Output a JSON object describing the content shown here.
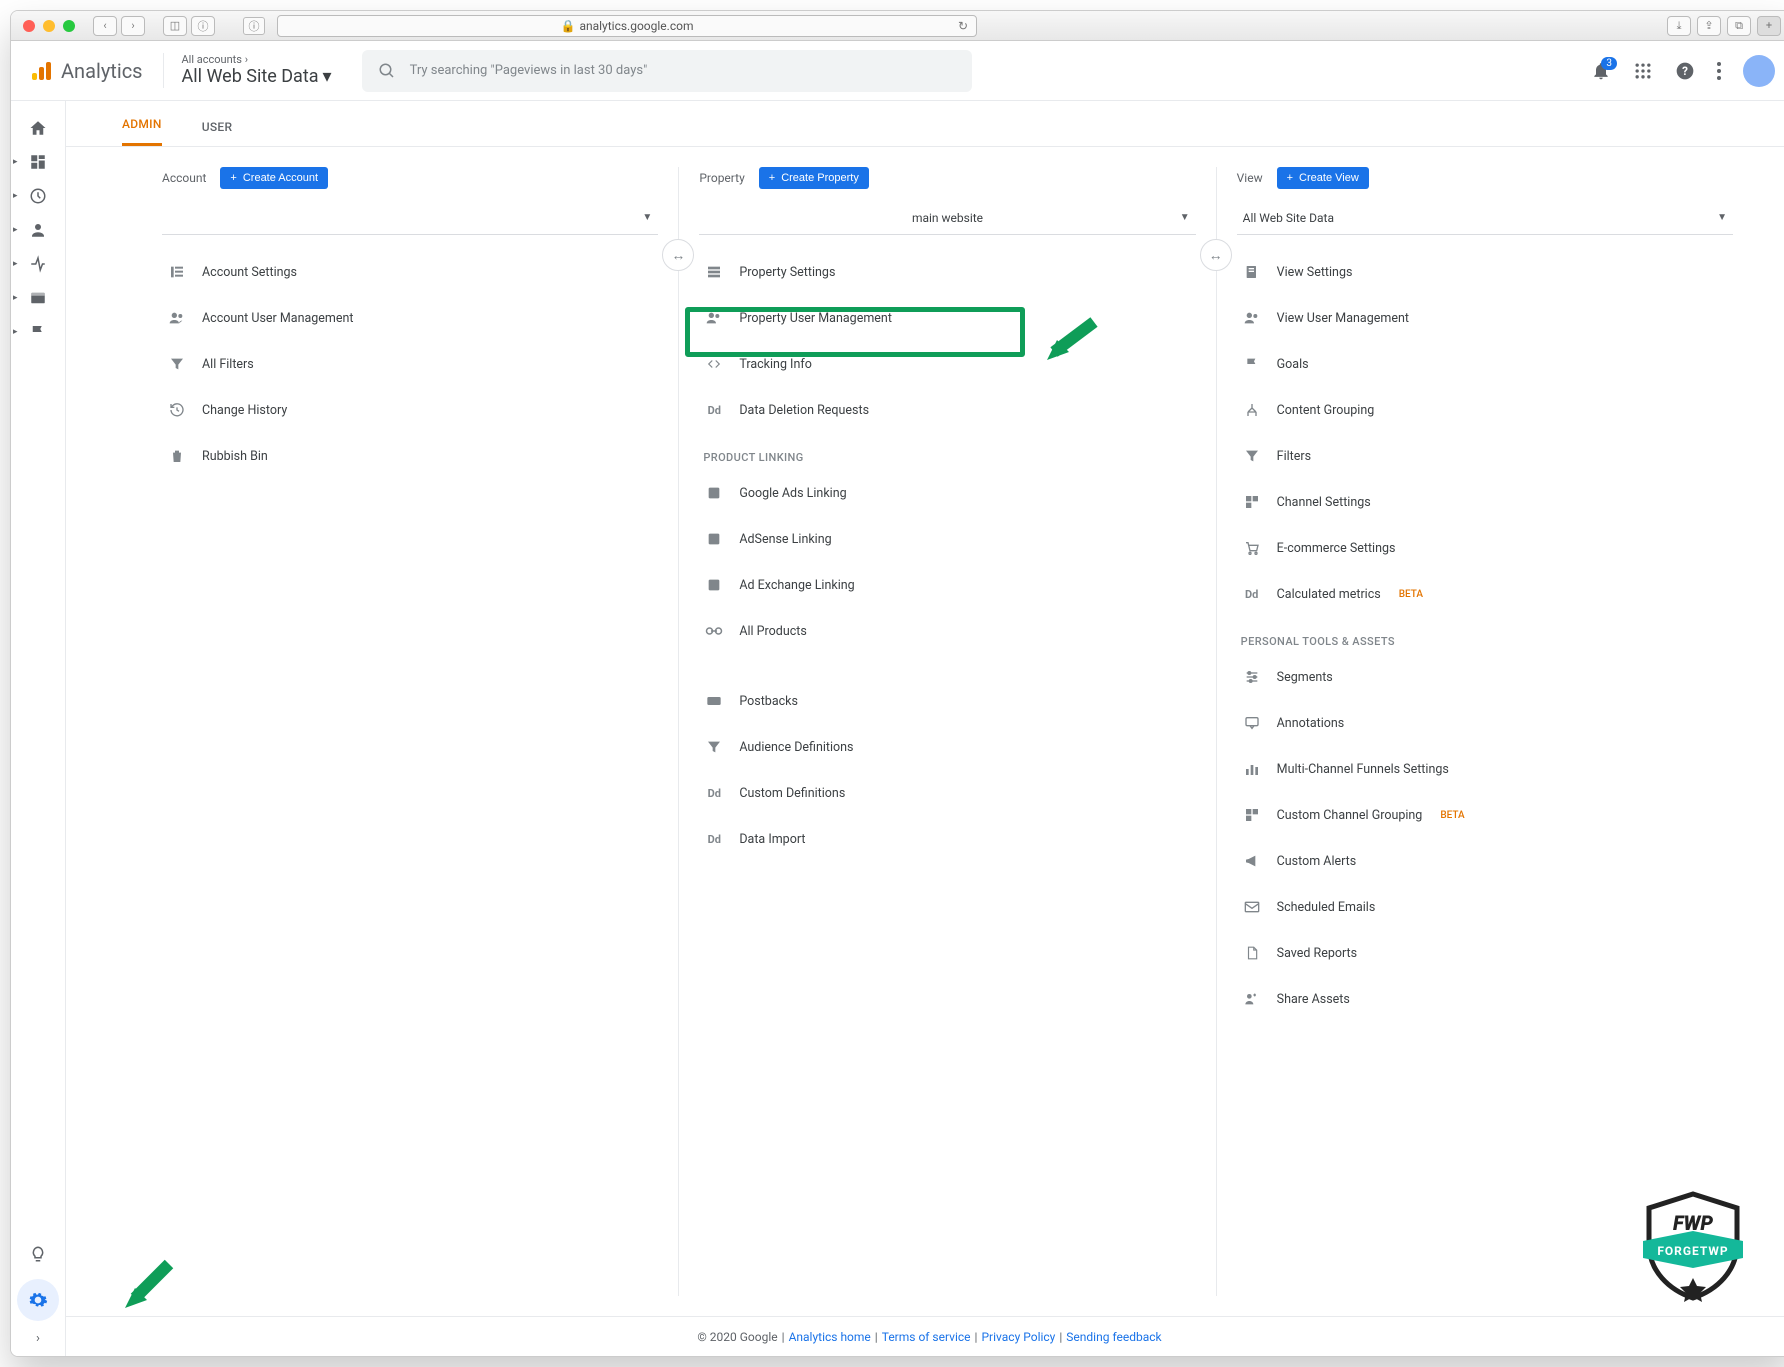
{
  "browser": {
    "url": "analytics.google.com",
    "info_glyph": "ⓘ",
    "lock_glyph": "🔒",
    "refresh_glyph": "↻"
  },
  "header": {
    "logo_text": "Analytics",
    "breadcrumb_top": "All accounts",
    "breadcrumb_main": "All Web Site Data",
    "search_placeholder": "Try searching \"Pageviews in last 30 days\"",
    "notif_count": "3"
  },
  "tabs": {
    "admin": "ADMIN",
    "user": "USER"
  },
  "columns": {
    "account": {
      "label": "Account",
      "create": "Create Account",
      "selector": "",
      "rows": [
        "Account Settings",
        "Account User Management",
        "All Filters",
        "Change History",
        "Rubbish Bin"
      ]
    },
    "property": {
      "label": "Property",
      "create": "Create Property",
      "selector": "main website",
      "rows": [
        "Property Settings",
        "Property User Management",
        "Tracking Info",
        "Data Deletion Requests"
      ],
      "section1": "PRODUCT LINKING",
      "rows2": [
        "Google Ads Linking",
        "AdSense Linking",
        "Ad Exchange Linking",
        "All Products"
      ],
      "rows3": [
        "Postbacks",
        "Audience Definitions",
        "Custom Definitions",
        "Data Import"
      ]
    },
    "view": {
      "label": "View",
      "create": "Create View",
      "selector": "All Web Site Data",
      "rows": [
        "View Settings",
        "View User Management",
        "Goals",
        "Content Grouping",
        "Filters",
        "Channel Settings",
        "E-commerce Settings"
      ],
      "calc_metrics_label": "Calculated metrics",
      "section1": "PERSONAL TOOLS & ASSETS",
      "rows2": [
        "Segments",
        "Annotations",
        "Multi-Channel Funnels Settings"
      ],
      "custom_channel_label": "Custom Channel Grouping",
      "rows3": [
        "Custom Alerts",
        "Scheduled Emails",
        "Saved Reports",
        "Share Assets"
      ],
      "beta": "BETA"
    }
  },
  "footer": {
    "copyright": "© 2020 Google",
    "links": [
      "Analytics home",
      "Terms of service",
      "Privacy Policy",
      "Sending feedback"
    ]
  },
  "watermark": {
    "text": "FORGETWP"
  }
}
